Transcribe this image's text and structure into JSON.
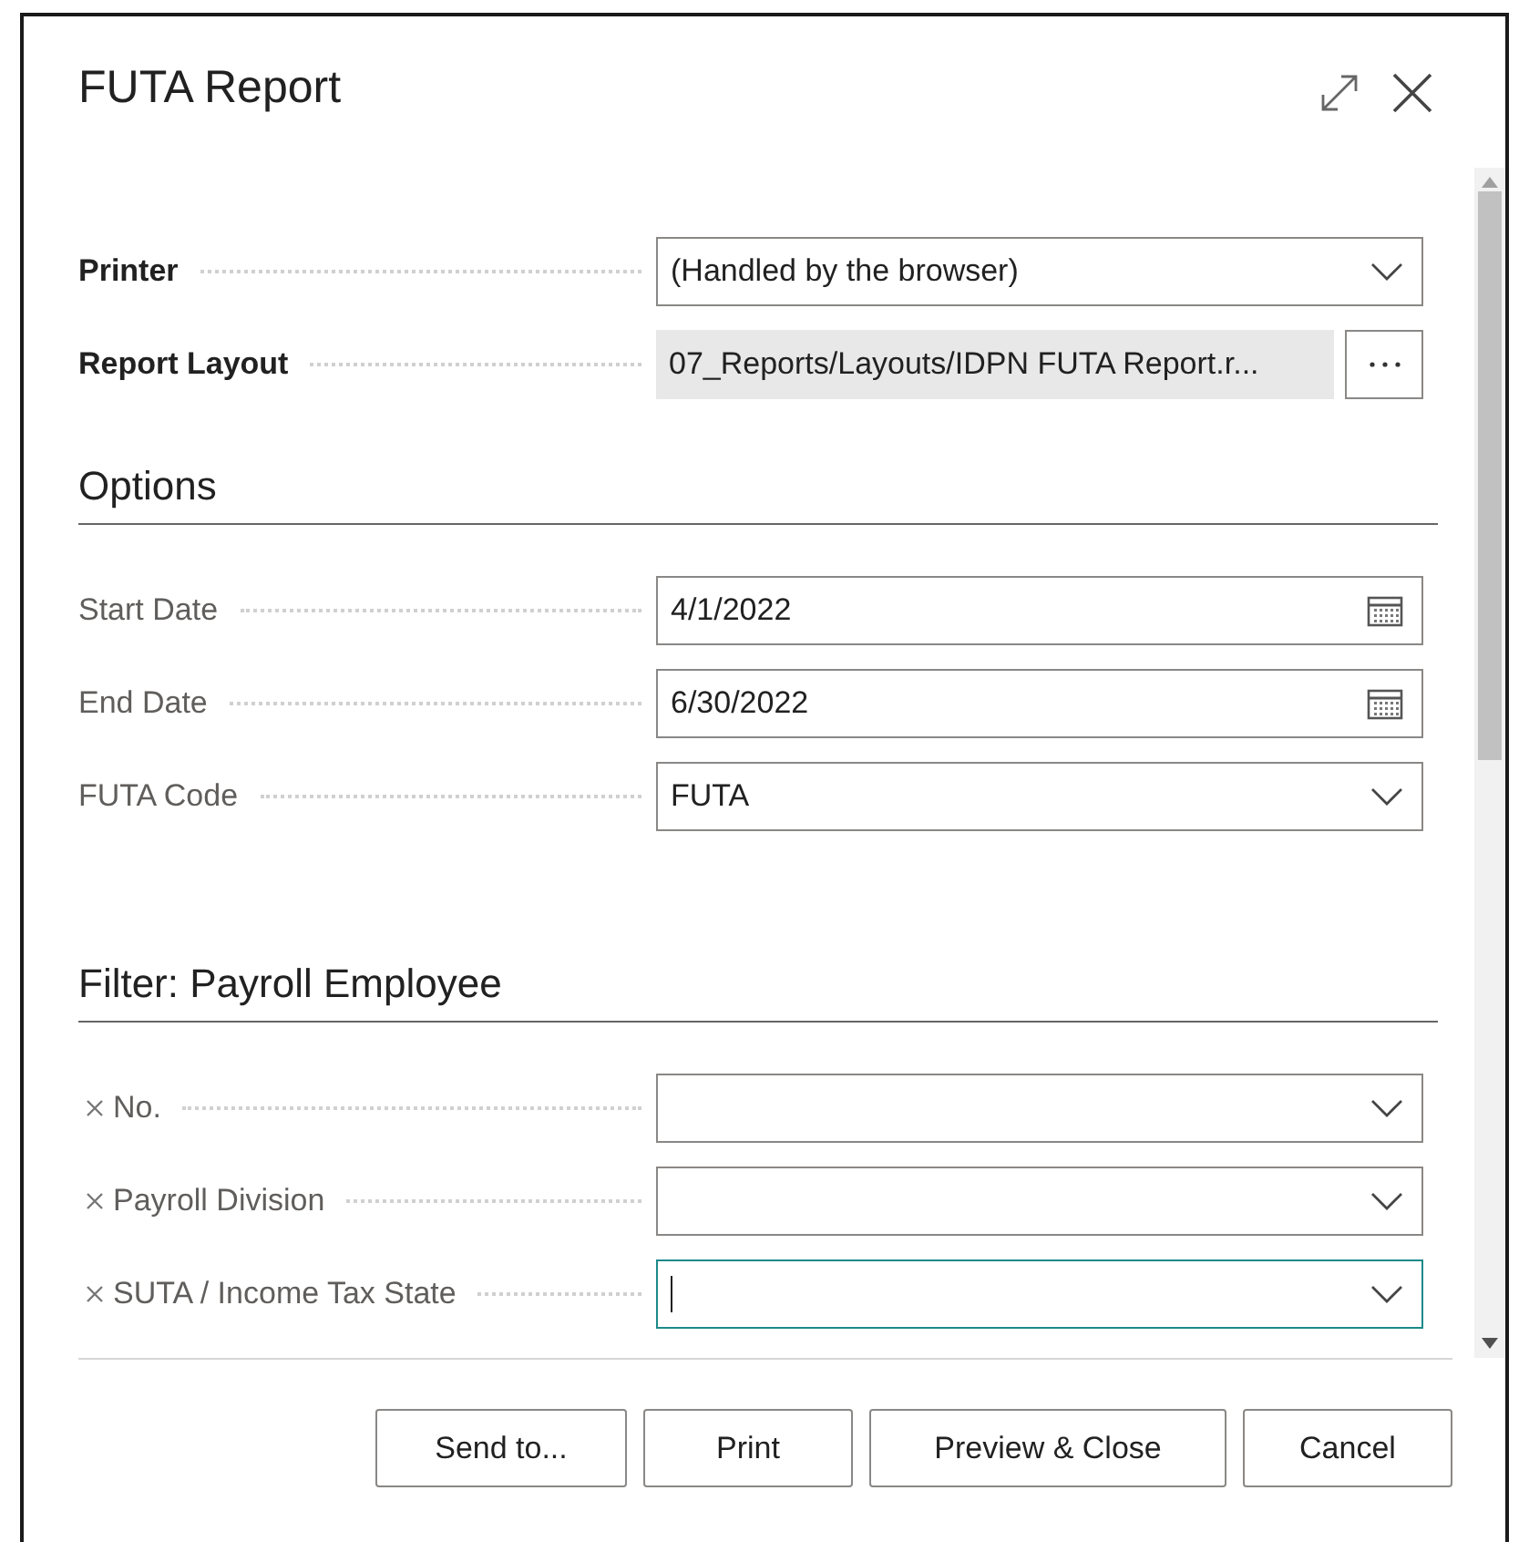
{
  "window": {
    "title": "FUTA Report"
  },
  "sections": [
    {
      "fields": [
        {
          "label": "Printer",
          "kind": "dropdown",
          "value": "(Handled by the browser)",
          "emphasized": true
        },
        {
          "label": "Report Layout",
          "kind": "lookup",
          "value": "07_Reports/Layouts/IDPN FUTA Report.r...",
          "emphasized": true
        }
      ]
    },
    {
      "heading": "Options",
      "fields": [
        {
          "label": "Start Date",
          "kind": "date",
          "value": "4/1/2022",
          "emphasized": false
        },
        {
          "label": "End Date",
          "kind": "date",
          "value": "6/30/2022",
          "emphasized": false
        },
        {
          "label": "FUTA Code",
          "kind": "dropdown",
          "value": "FUTA",
          "emphasized": false
        }
      ]
    },
    {
      "heading": "Filter: Payroll Employee",
      "fields": [
        {
          "label": "No.",
          "kind": "dropdown",
          "emphasized": false,
          "removable": true,
          "focused": false
        },
        {
          "label": "Payroll Division",
          "kind": "dropdown",
          "emphasized": false,
          "removable": true,
          "focused": false
        },
        {
          "label": "SUTA / Income Tax State",
          "kind": "dropdown",
          "emphasized": false,
          "removable": true,
          "focused": true
        }
      ]
    }
  ],
  "buttons": [
    "Send to...",
    "Print",
    "Preview & Close",
    "Cancel"
  ]
}
